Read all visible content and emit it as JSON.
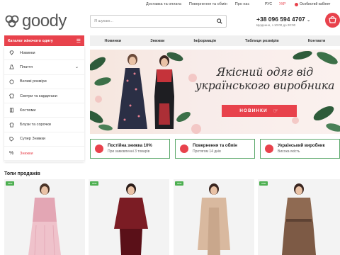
{
  "brand": {
    "name": "goody"
  },
  "top_links": [
    "Доставка та оплата",
    "Повернення та обмін",
    "Про нас"
  ],
  "languages": [
    "РУС",
    "УКР"
  ],
  "active_language": "УКР",
  "account_label": "Особистий кабінет",
  "search": {
    "placeholder": "Я шукаю..."
  },
  "contact": {
    "phone": "+38 096 594 4707",
    "hours": "Щоденно, з 10:00 до 20:00"
  },
  "catalog_button": "Каталог жіночого одягу",
  "nav": [
    "Новинки",
    "Знижки",
    "Інформація",
    "Таблиця розмірів",
    "Контакти"
  ],
  "sidebar": [
    {
      "label": "Новинки",
      "icon": "diamond-icon"
    },
    {
      "label": "Плаття",
      "icon": "dress-icon",
      "chevron": true
    },
    {
      "label": "Великі розміри",
      "icon": "sizes-icon"
    },
    {
      "label": "Светри та кардигани",
      "icon": "sweater-icon"
    },
    {
      "label": "Костюми",
      "icon": "suit-icon"
    },
    {
      "label": "Блузи та сорочки",
      "icon": "blouse-icon"
    },
    {
      "label": "Супер Знижки",
      "icon": "tag-icon"
    },
    {
      "label": "Знижки",
      "icon": "percent-icon",
      "accent": true
    }
  ],
  "banner": {
    "title_line1": "Якісний одяг від",
    "title_line2": "українського виробника",
    "button": "НОВИНКИ"
  },
  "features": [
    {
      "title": "Постійна знижка 10%",
      "subtitle": "При замовленні 3 товарів",
      "icon": "percent-icon"
    },
    {
      "title": "Повернення та обмін",
      "subtitle": "Протягом 14 днів",
      "icon": "return-icon"
    },
    {
      "title": "Український виробник",
      "subtitle": "Висока якість",
      "icon": "heart-icon"
    }
  ],
  "products_title": "Топи продажів",
  "products": [
    {
      "badge": "new",
      "outfit_color": "#e3a6b4",
      "skirt_color": "#efc2cb"
    },
    {
      "badge": "new",
      "outfit_color": "#7b1c24",
      "skirt_color": "#5a1018"
    },
    {
      "badge": "new",
      "outfit_color": "#d9b99f",
      "skirt_color": "#c9a78c"
    },
    {
      "badge": "new",
      "outfit_color": "#8f6a52",
      "skirt_color": "#7d5a45"
    }
  ],
  "colors": {
    "accent": "#e8424c",
    "feature_border": "#5aa86a",
    "nav_bg": "#f0f0f0"
  }
}
